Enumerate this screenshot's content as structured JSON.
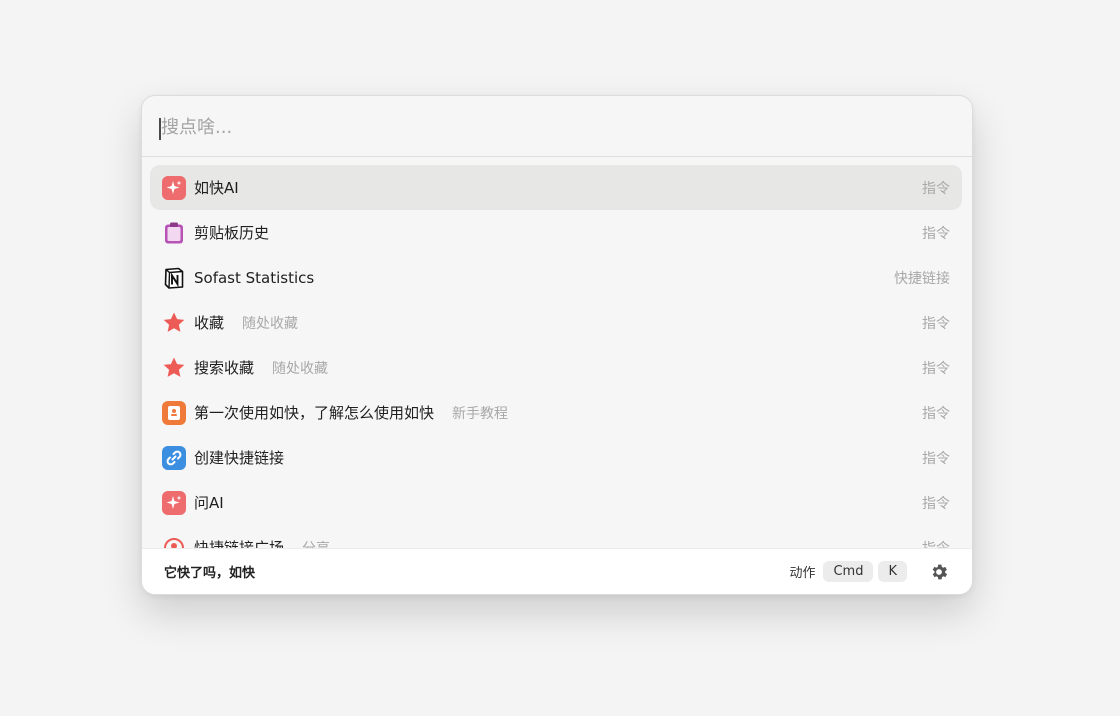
{
  "search": {
    "placeholder": "搜点啥...",
    "value": ""
  },
  "items": [
    {
      "title": "如快AI",
      "subtitle": "",
      "kind": "指令",
      "icon": "sparkle-icon",
      "selected": true
    },
    {
      "title": "剪贴板历史",
      "subtitle": "",
      "kind": "指令",
      "icon": "clipboard-icon"
    },
    {
      "title": "Sofast Statistics",
      "subtitle": "",
      "kind": "快捷链接",
      "icon": "notion-icon"
    },
    {
      "title": "收藏",
      "subtitle": "随处收藏",
      "kind": "指令",
      "icon": "star-icon"
    },
    {
      "title": "搜索收藏",
      "subtitle": "随处收藏",
      "kind": "指令",
      "icon": "star-icon"
    },
    {
      "title": "第一次使用如快，了解怎么使用如快",
      "subtitle": "新手教程",
      "kind": "指令",
      "icon": "tutorial-icon"
    },
    {
      "title": "创建快捷链接",
      "subtitle": "",
      "kind": "指令",
      "icon": "link-icon"
    },
    {
      "title": "问AI",
      "subtitle": "",
      "kind": "指令",
      "icon": "sparkle-icon"
    },
    {
      "title": "快捷链接广场",
      "subtitle": "分享",
      "kind": "指令",
      "icon": "share-icon"
    }
  ],
  "footer": {
    "tagline": "它快了吗，如快",
    "action_label": "动作",
    "key_cmd": "Cmd",
    "key_k": "K",
    "settings_icon": "gear-icon"
  },
  "colors": {
    "sparkle": "#ee6b6e",
    "clipboard": "#b653b4",
    "star": "#ec5b56",
    "tutorial": "#f07a3a",
    "link": "#3b8ee0",
    "selected_row": "#e7e7e6"
  }
}
